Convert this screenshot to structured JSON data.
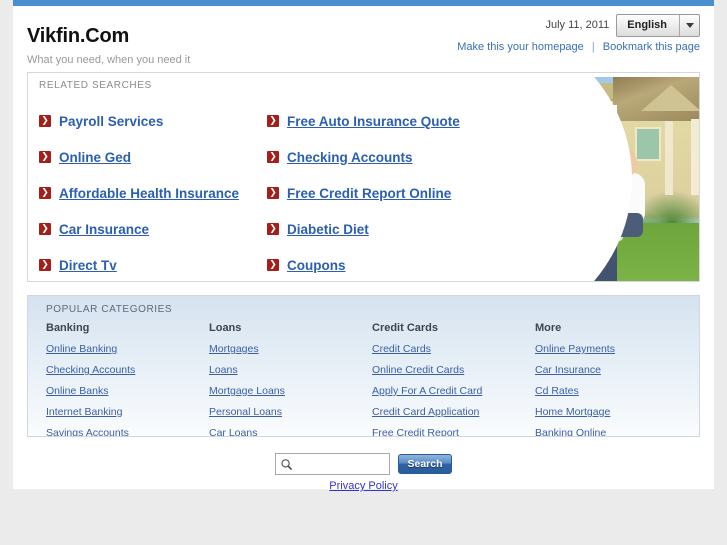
{
  "header": {
    "brand_title": "Vikfin.Com",
    "tagline": "What you need, when you need it",
    "date": "July 11, 2011",
    "language": "English",
    "homepage_link": "Make this your homepage",
    "bookmark_link": "Bookmark this page",
    "link_separator": "|",
    "top_bar_color": "#4a8ed0"
  },
  "related": {
    "title": "RELATED SEARCHES",
    "bullet_glyph": "❯",
    "bullet_color": "#a41f1a",
    "link_color": "#2b5fb0",
    "left_column": [
      {
        "label": "Payroll Services",
        "underlined": false
      },
      {
        "label": "Online Ged",
        "underlined": true
      },
      {
        "label": "Affordable Health Insurance",
        "underlined": true
      },
      {
        "label": "Car Insurance",
        "underlined": true
      },
      {
        "label": "Direct Tv",
        "underlined": true
      }
    ],
    "right_column": [
      {
        "label": "Free Auto Insurance Quote",
        "underlined": true
      },
      {
        "label": "Checking Accounts",
        "underlined": true
      },
      {
        "label": "Free Credit Report Online",
        "underlined": true
      },
      {
        "label": "Diabetic Diet",
        "underlined": true
      },
      {
        "label": "Coupons",
        "underlined": true
      }
    ]
  },
  "categories": {
    "title": "POPULAR CATEGORIES",
    "columns": [
      {
        "heading": "Banking",
        "links": [
          "Online Banking",
          "Checking Accounts",
          "Online Banks",
          "Internet Banking",
          "Savings Accounts"
        ]
      },
      {
        "heading": "Loans",
        "links": [
          "Mortgages",
          "Loans",
          "Mortgage Loans",
          "Personal Loans",
          "Car Loans"
        ]
      },
      {
        "heading": "Credit Cards",
        "links": [
          "Credit Cards",
          "Online Credit Cards",
          "Apply For A Credit Card",
          "Credit Card Application",
          "Free Credit Report"
        ]
      },
      {
        "heading": "More",
        "links": [
          "Online Payments",
          "Car Insurance",
          "Cd Rates",
          "Home Mortgage",
          "Banking Online"
        ]
      }
    ]
  },
  "search": {
    "value": "",
    "placeholder": "",
    "button_label": "Search",
    "icon": "magnifier-icon"
  },
  "footer": {
    "privacy_label": "Privacy Policy"
  }
}
